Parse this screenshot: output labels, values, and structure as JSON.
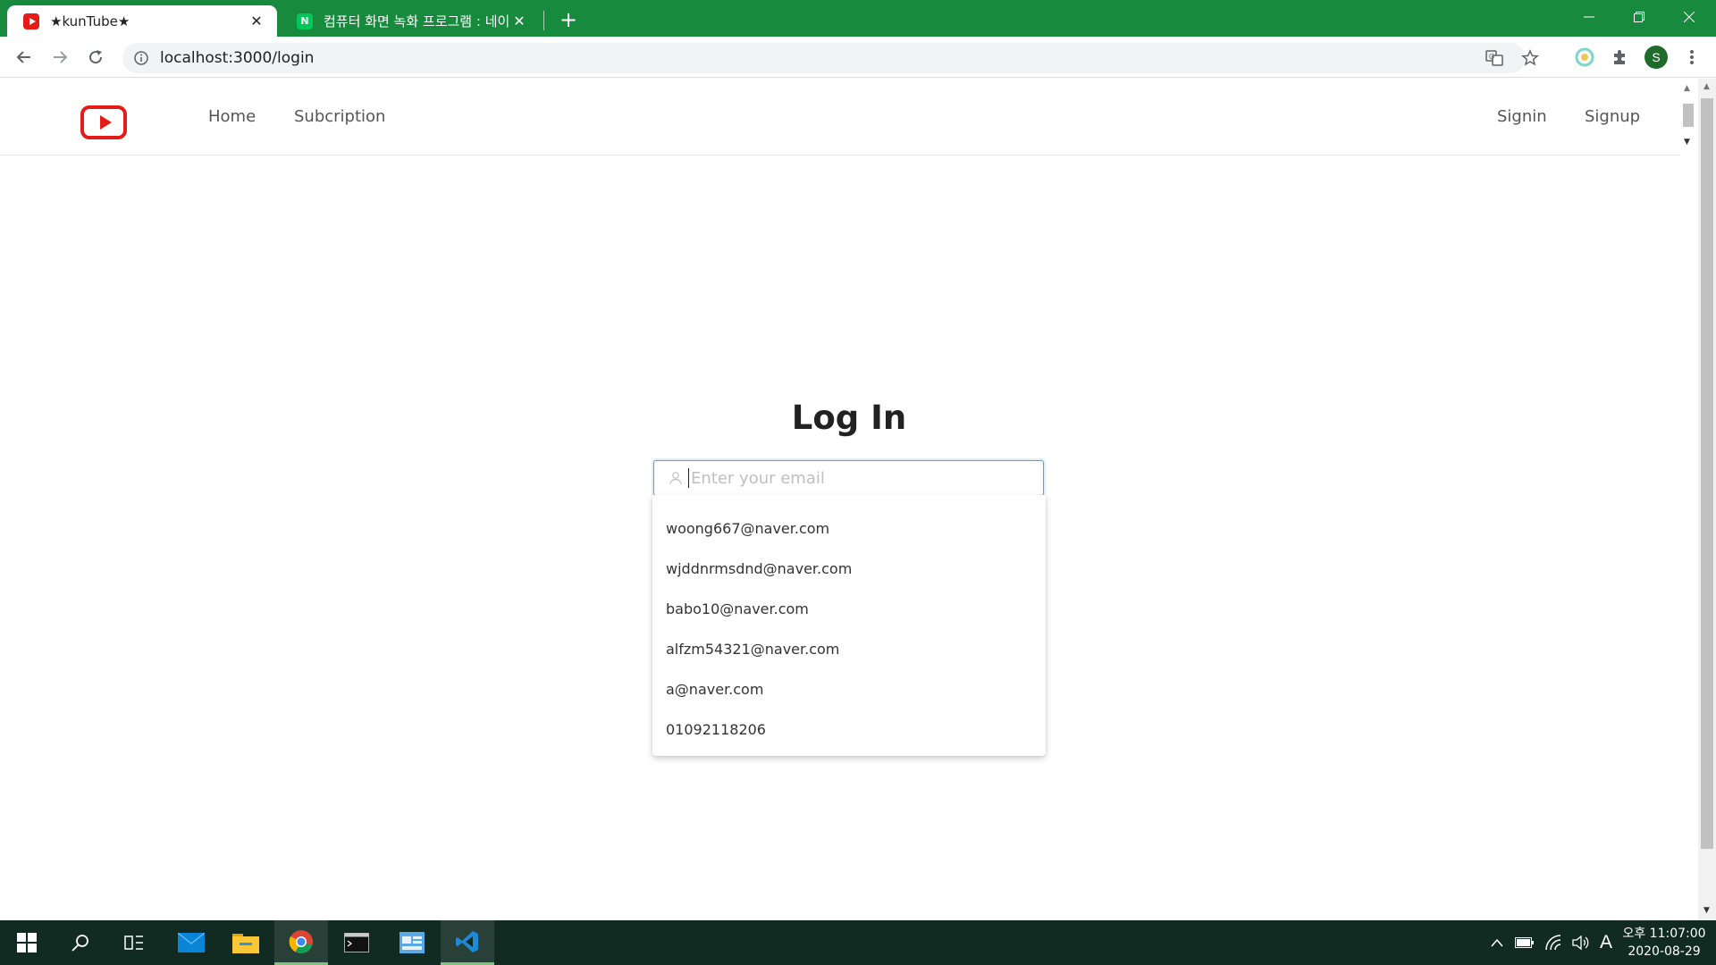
{
  "browser": {
    "tabs": [
      {
        "title": "★kunTube★",
        "active": true
      },
      {
        "title": "컴퓨터 화면 녹화 프로그램 : 네이",
        "active": false
      }
    ],
    "url": "localhost:3000/login",
    "profile_initial": "S"
  },
  "site": {
    "nav": {
      "home": "Home",
      "subscription": "Subcription",
      "signin": "Signin",
      "signup": "Signup"
    },
    "login": {
      "title": "Log In",
      "email_placeholder": "Enter your email",
      "suggestions": [
        "woong667@naver.com",
        "wjddnrmsdnd@naver.com",
        "babo10@naver.com",
        "alfzm54321@naver.com",
        "a@naver.com",
        "01092118206"
      ]
    }
  },
  "taskbar": {
    "ime_indicator": "A",
    "time": "오후 11:07:00",
    "date": "2020-08-29"
  },
  "colors": {
    "tab_strip": "#188a3e",
    "brand_red": "#e41b17",
    "focus_border": "#40a9ff",
    "taskbar": "#112b22"
  }
}
